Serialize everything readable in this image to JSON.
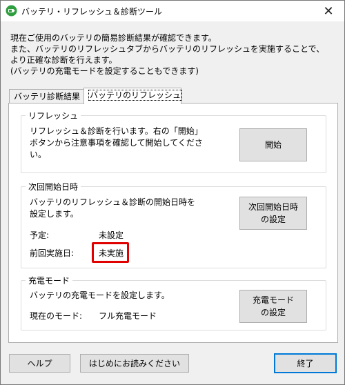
{
  "window": {
    "title": "バッテリ・リフレッシュ＆診断ツール",
    "close_glyph": "✕"
  },
  "intro": [
    "現在ご使用のバッテリの簡易診断結果が確認できます。",
    "また、バッテリのリフレッシュタブからバッテリのリフレッシュを実施することで、",
    "より正確な診断を行えます。",
    "(バッテリの充電モードを設定することもできます)"
  ],
  "tabs": {
    "diagnosis": "バッテリ診断結果",
    "refresh": "バッテリのリフレッシュ"
  },
  "refresh_group": {
    "title": "リフレッシュ",
    "text": [
      "リフレッシュ＆診断を行います。右の「開始」",
      "ボタンから注意事項を確認して開始してくださ",
      "い。"
    ],
    "start_button": "開始"
  },
  "next_start_group": {
    "title": "次回開始日時",
    "text": [
      "バッテリのリフレッシュ＆診断の開始日時を",
      "設定します。"
    ],
    "scheduled_label": "予定:",
    "scheduled_value": "未設定",
    "last_run_label": "前回実施日:",
    "last_run_value": "未実施",
    "set_button": [
      "次回開始日時",
      "の設定"
    ]
  },
  "charge_mode_group": {
    "title": "充電モード",
    "text": "バッテリの充電モードを設定します。",
    "current_label": "現在のモード:",
    "current_value": "フル充電モード",
    "set_button": [
      "充電モード",
      "の設定"
    ]
  },
  "footer": {
    "help_button": "ヘルプ",
    "readme_button": "はじめにお読みください",
    "exit_button": "終了"
  },
  "colors": {
    "highlight": "#e00000",
    "default_button_border": "#0078d7",
    "app_icon": "#2e9e3e"
  },
  "icons": {
    "app": "battery-app-icon",
    "close": "close-icon"
  }
}
